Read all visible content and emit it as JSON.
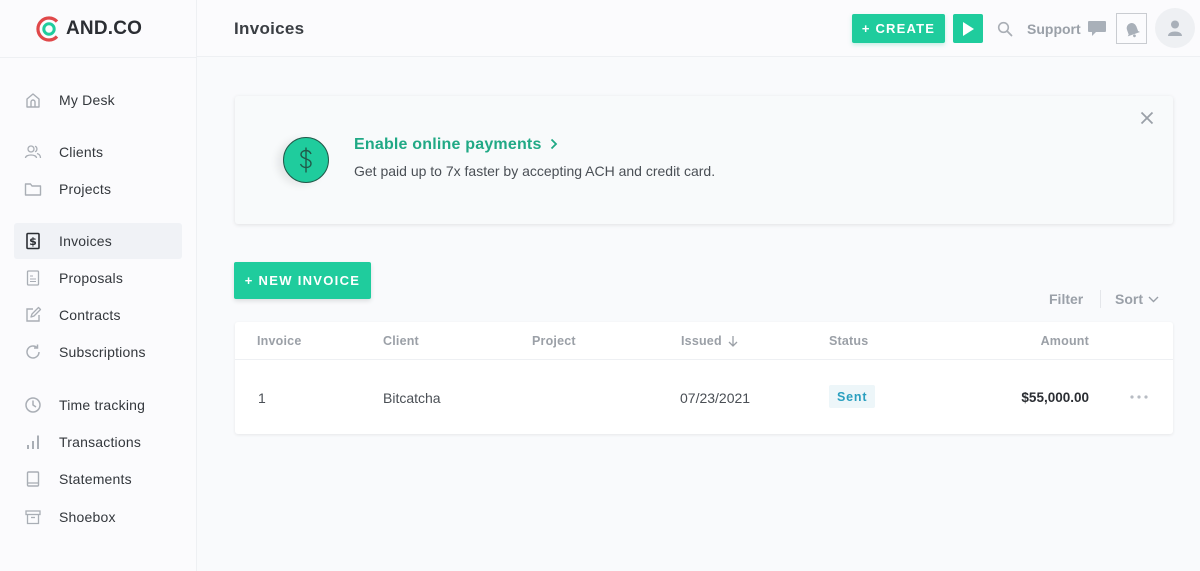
{
  "app": {
    "brand": "AND.CO",
    "colors": {
      "accent": "#1fcc9d",
      "accent_text": "#20a985",
      "logo_red": "#e0484a",
      "status_sent": "#2a9fbf"
    }
  },
  "header": {
    "title": "Invoices",
    "create_label": "+ CREATE",
    "play_icon": "play-icon",
    "search_icon": "search-icon",
    "support_label": "Support",
    "support_icon": "chat-bubble-icon",
    "notifications_icon": "bell-icon",
    "avatar_icon": "user-icon"
  },
  "sidebar": {
    "items": [
      {
        "label": "My Desk",
        "icon": "home-icon",
        "active": false
      },
      {
        "label": "Clients",
        "icon": "users-icon",
        "active": false
      },
      {
        "label": "Projects",
        "icon": "folder-icon",
        "active": false
      },
      {
        "label": "Invoices",
        "icon": "invoice-dollar-icon",
        "active": true
      },
      {
        "label": "Proposals",
        "icon": "document-icon",
        "active": false
      },
      {
        "label": "Contracts",
        "icon": "edit-icon",
        "active": false
      },
      {
        "label": "Subscriptions",
        "icon": "refresh-icon",
        "active": false
      },
      {
        "label": "Time tracking",
        "icon": "clock-icon",
        "active": false
      },
      {
        "label": "Transactions",
        "icon": "bar-chart-icon",
        "active": false
      },
      {
        "label": "Statements",
        "icon": "book-icon",
        "active": false
      },
      {
        "label": "Shoebox",
        "icon": "archive-box-icon",
        "active": false
      }
    ]
  },
  "banner": {
    "icon": "dollar-coin-icon",
    "title": "Enable online payments",
    "chevron": "›",
    "subtitle": "Get paid up to 7x faster by accepting ACH and credit card.",
    "close_icon": "close-icon"
  },
  "actions": {
    "new_invoice_label": "+ NEW INVOICE",
    "filter_label": "Filter",
    "sort_label": "Sort"
  },
  "table": {
    "columns": [
      "Invoice",
      "Client",
      "Project",
      "Issued",
      "Status",
      "Amount"
    ],
    "sorted_column": "Issued",
    "sort_direction": "descending",
    "rows": [
      {
        "invoice": "1",
        "client": "Bitcatcha",
        "project": "",
        "issued": "07/23/2021",
        "status": "Sent",
        "amount": "$55,000.00"
      }
    ]
  }
}
